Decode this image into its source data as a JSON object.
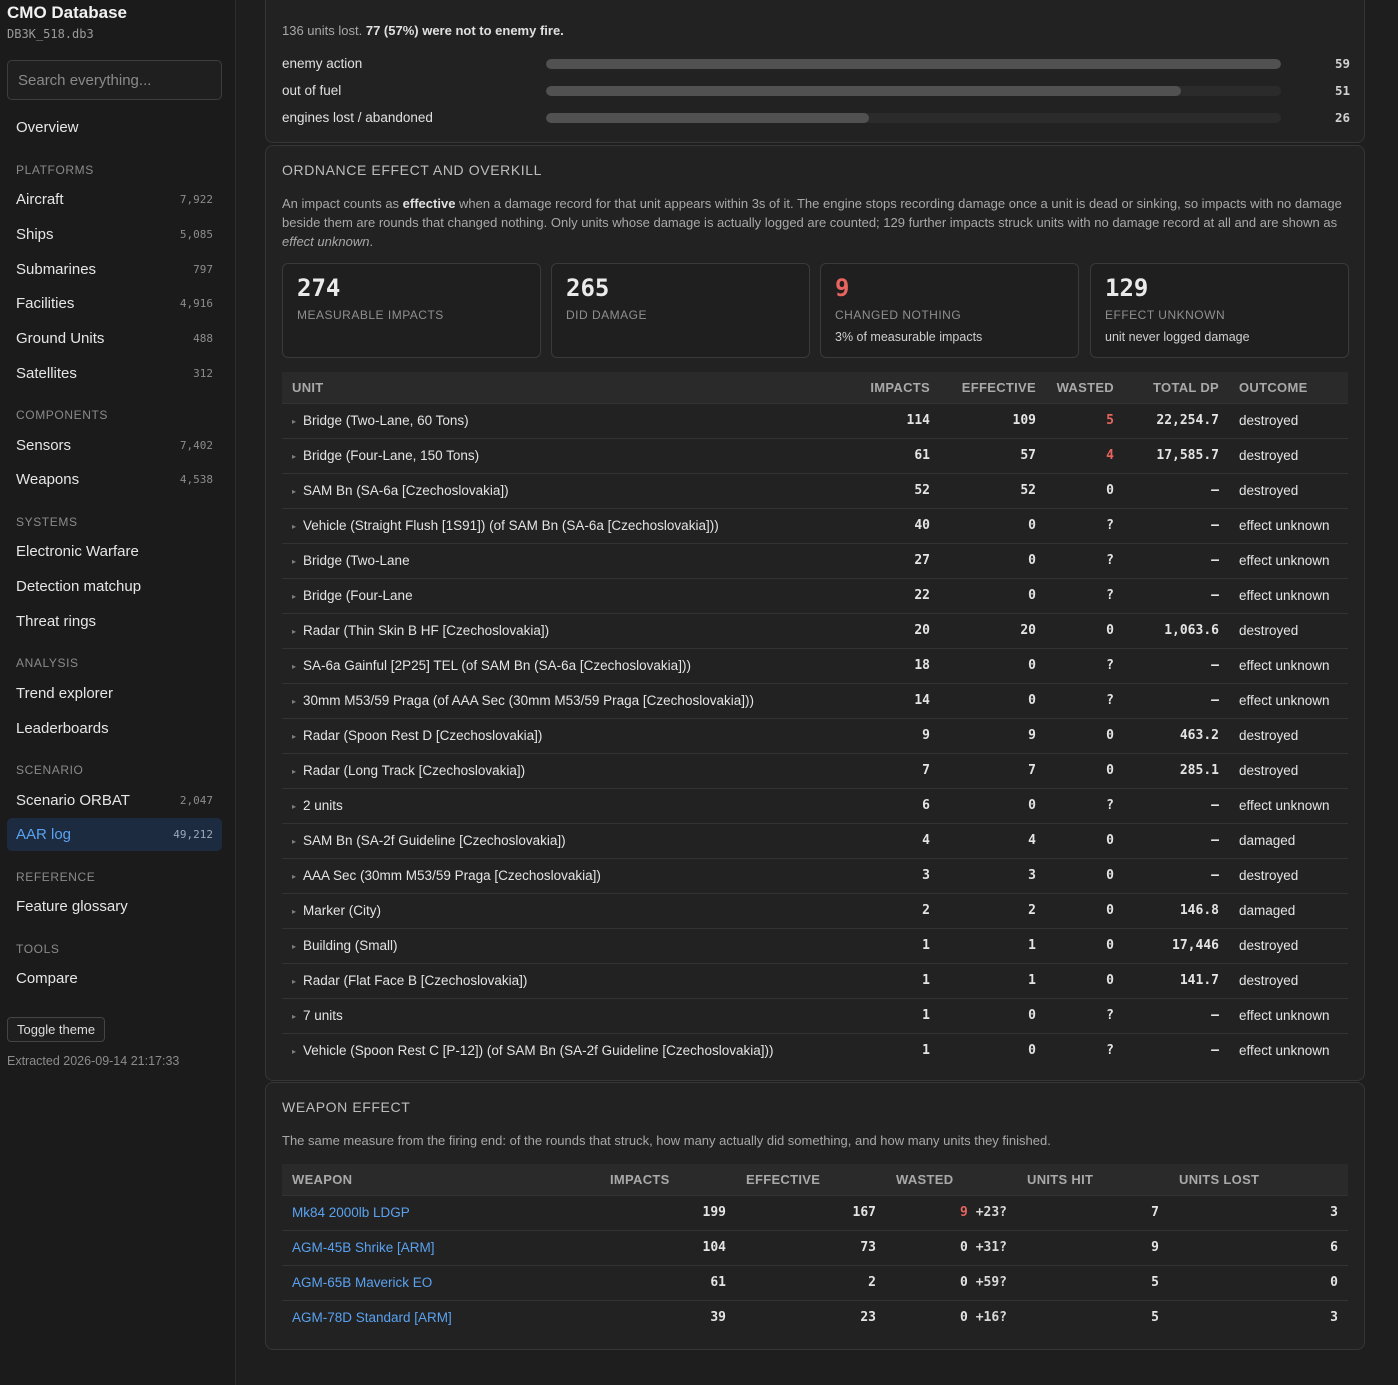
{
  "app": {
    "title": "CMO Database",
    "db_file": "DB3K_518.db3"
  },
  "search": {
    "placeholder": "Search everything..."
  },
  "nav": {
    "overview": "Overview",
    "sections": {
      "platforms": "PLATFORMS",
      "components": "COMPONENTS",
      "systems": "SYSTEMS",
      "analysis": "ANALYSIS",
      "scenario": "SCENARIO",
      "reference": "REFERENCE",
      "tools": "TOOLS"
    },
    "items": {
      "aircraft": {
        "label": "Aircraft",
        "count": "7,922"
      },
      "ships": {
        "label": "Ships",
        "count": "5,085"
      },
      "submarines": {
        "label": "Submarines",
        "count": "797"
      },
      "facilities": {
        "label": "Facilities",
        "count": "4,916"
      },
      "ground_units": {
        "label": "Ground Units",
        "count": "488"
      },
      "satellites": {
        "label": "Satellites",
        "count": "312"
      },
      "sensors": {
        "label": "Sensors",
        "count": "7,402"
      },
      "weapons": {
        "label": "Weapons",
        "count": "4,538"
      },
      "electronic_warfare": {
        "label": "Electronic Warfare"
      },
      "detection_matchup": {
        "label": "Detection matchup"
      },
      "threat_rings": {
        "label": "Threat rings"
      },
      "trend_explorer": {
        "label": "Trend explorer"
      },
      "leaderboards": {
        "label": "Leaderboards"
      },
      "scenario_orbat": {
        "label": "Scenario ORBAT",
        "count": "2,047"
      },
      "aar_log": {
        "label": "AAR log",
        "count": "49,212"
      },
      "feature_glossary": {
        "label": "Feature glossary"
      },
      "compare": {
        "label": "Compare"
      }
    },
    "toggle_theme": "Toggle theme",
    "extracted": "Extracted 2026-09-14 21:17:33"
  },
  "losses": {
    "summary_pre": "136 units lost.",
    "summary_bold": "77 (57%) were not to enemy fire.",
    "rows": [
      {
        "label": "enemy action",
        "value": "59",
        "fraction": 1.0
      },
      {
        "label": "out of fuel",
        "value": "51",
        "fraction": 0.864
      },
      {
        "label": "engines lost / abandoned",
        "value": "26",
        "fraction": 0.44
      }
    ]
  },
  "ordnance": {
    "title": "ORDNANCE EFFECT AND OVERKILL",
    "desc": {
      "p1": "An impact counts as ",
      "b1": "effective",
      "p2": " when a damage record for that unit appears within 3s of it. The engine stops recording damage once a unit is dead or sinking, so impacts with no damage beside them are rounds that changed nothing. Only units whose damage is actually logged are counted; 129 further impacts struck units with no damage record at all and are shown as ",
      "i1": "effect unknown",
      "p3": "."
    },
    "cards": [
      {
        "value": "274",
        "label": "MEASURABLE IMPACTS",
        "sub": ""
      },
      {
        "value": "265",
        "label": "DID DAMAGE",
        "sub": ""
      },
      {
        "value": "9",
        "label": "CHANGED NOTHING",
        "sub": "3% of measurable impacts"
      },
      {
        "value": "129",
        "label": "EFFECT UNKNOWN",
        "sub": "unit never logged damage"
      }
    ],
    "columns": [
      "UNIT",
      "IMPACTS",
      "EFFECTIVE",
      "WASTED",
      "TOTAL DP",
      "OUTCOME"
    ],
    "rows": [
      {
        "unit": "Bridge (Two-Lane, 60 Tons)",
        "impacts": "114",
        "effective": "109",
        "wasted": "5",
        "dp": "22,254.7",
        "outcome": "destroyed"
      },
      {
        "unit": "Bridge (Four-Lane, 150 Tons)",
        "impacts": "61",
        "effective": "57",
        "wasted": "4",
        "dp": "17,585.7",
        "outcome": "destroyed"
      },
      {
        "unit": "SAM Bn (SA-6a [Czechoslovakia])",
        "impacts": "52",
        "effective": "52",
        "wasted": "0",
        "dp": "–",
        "outcome": "destroyed"
      },
      {
        "unit": "Vehicle (Straight Flush [1S91]) (of SAM Bn (SA-6a [Czechoslovakia]))",
        "impacts": "40",
        "effective": "0",
        "wasted": "?",
        "dp": "–",
        "outcome": "effect unknown"
      },
      {
        "unit": "Bridge (Two-Lane",
        "impacts": "27",
        "effective": "0",
        "wasted": "?",
        "dp": "–",
        "outcome": "effect unknown"
      },
      {
        "unit": "Bridge (Four-Lane",
        "impacts": "22",
        "effective": "0",
        "wasted": "?",
        "dp": "–",
        "outcome": "effect unknown"
      },
      {
        "unit": "Radar (Thin Skin B HF [Czechoslovakia])",
        "impacts": "20",
        "effective": "20",
        "wasted": "0",
        "dp": "1,063.6",
        "outcome": "destroyed"
      },
      {
        "unit": "SA-6a Gainful [2P25] TEL (of SAM Bn (SA-6a [Czechoslovakia]))",
        "impacts": "18",
        "effective": "0",
        "wasted": "?",
        "dp": "–",
        "outcome": "effect unknown"
      },
      {
        "unit": "30mm M53/59 Praga (of AAA Sec (30mm M53/59 Praga [Czechoslovakia]))",
        "impacts": "14",
        "effective": "0",
        "wasted": "?",
        "dp": "–",
        "outcome": "effect unknown"
      },
      {
        "unit": "Radar (Spoon Rest D [Czechoslovakia])",
        "impacts": "9",
        "effective": "9",
        "wasted": "0",
        "dp": "463.2",
        "outcome": "destroyed"
      },
      {
        "unit": "Radar (Long Track [Czechoslovakia])",
        "impacts": "7",
        "effective": "7",
        "wasted": "0",
        "dp": "285.1",
        "outcome": "destroyed"
      },
      {
        "unit": "2 units",
        "impacts": "6",
        "effective": "0",
        "wasted": "?",
        "dp": "–",
        "outcome": "effect unknown"
      },
      {
        "unit": "SAM Bn (SA-2f Guideline [Czechoslovakia])",
        "impacts": "4",
        "effective": "4",
        "wasted": "0",
        "dp": "–",
        "outcome": "damaged"
      },
      {
        "unit": "AAA Sec (30mm M53/59 Praga [Czechoslovakia])",
        "impacts": "3",
        "effective": "3",
        "wasted": "0",
        "dp": "–",
        "outcome": "destroyed"
      },
      {
        "unit": "Marker (City)",
        "impacts": "2",
        "effective": "2",
        "wasted": "0",
        "dp": "146.8",
        "outcome": "damaged"
      },
      {
        "unit": "Building (Small)",
        "impacts": "1",
        "effective": "1",
        "wasted": "0",
        "dp": "17,446",
        "outcome": "destroyed"
      },
      {
        "unit": "Radar (Flat Face B [Czechoslovakia])",
        "impacts": "1",
        "effective": "1",
        "wasted": "0",
        "dp": "141.7",
        "outcome": "destroyed"
      },
      {
        "unit": "7 units",
        "impacts": "1",
        "effective": "0",
        "wasted": "?",
        "dp": "–",
        "outcome": "effect unknown"
      },
      {
        "unit": "Vehicle (Spoon Rest C [P-12]) (of SAM Bn (SA-2f Guideline [Czechoslovakia]))",
        "impacts": "1",
        "effective": "0",
        "wasted": "?",
        "dp": "–",
        "outcome": "effect unknown"
      }
    ]
  },
  "weapon_effect": {
    "title": "WEAPON EFFECT",
    "desc": "The same measure from the firing end: of the rounds that struck, how many actually did something, and how many units they finished.",
    "columns": [
      "WEAPON",
      "IMPACTS",
      "EFFECTIVE",
      "WASTED",
      "UNITS HIT",
      "UNITS LOST"
    ],
    "rows": [
      {
        "weapon": "Mk84 2000lb LDGP",
        "impacts": "199",
        "effective": "167",
        "wasted": "9",
        "wasted_extra": "+23?",
        "units_hit": "7",
        "units_lost": "3"
      },
      {
        "weapon": "AGM-45B Shrike [ARM]",
        "impacts": "104",
        "effective": "73",
        "wasted": "0",
        "wasted_extra": "+31?",
        "units_hit": "9",
        "units_lost": "6"
      },
      {
        "weapon": "AGM-65B Maverick EO",
        "impacts": "61",
        "effective": "2",
        "wasted": "0",
        "wasted_extra": "+59?",
        "units_hit": "5",
        "units_lost": "0"
      },
      {
        "weapon": "AGM-78D Standard [ARM]",
        "impacts": "39",
        "effective": "23",
        "wasted": "0",
        "wasted_extra": "+16?",
        "units_hit": "5",
        "units_lost": "3"
      }
    ]
  },
  "colors": {
    "accent": "#5aa2f0",
    "warning_red": "#e8645f",
    "background": "#1e1e1e",
    "panel": "#222222"
  }
}
